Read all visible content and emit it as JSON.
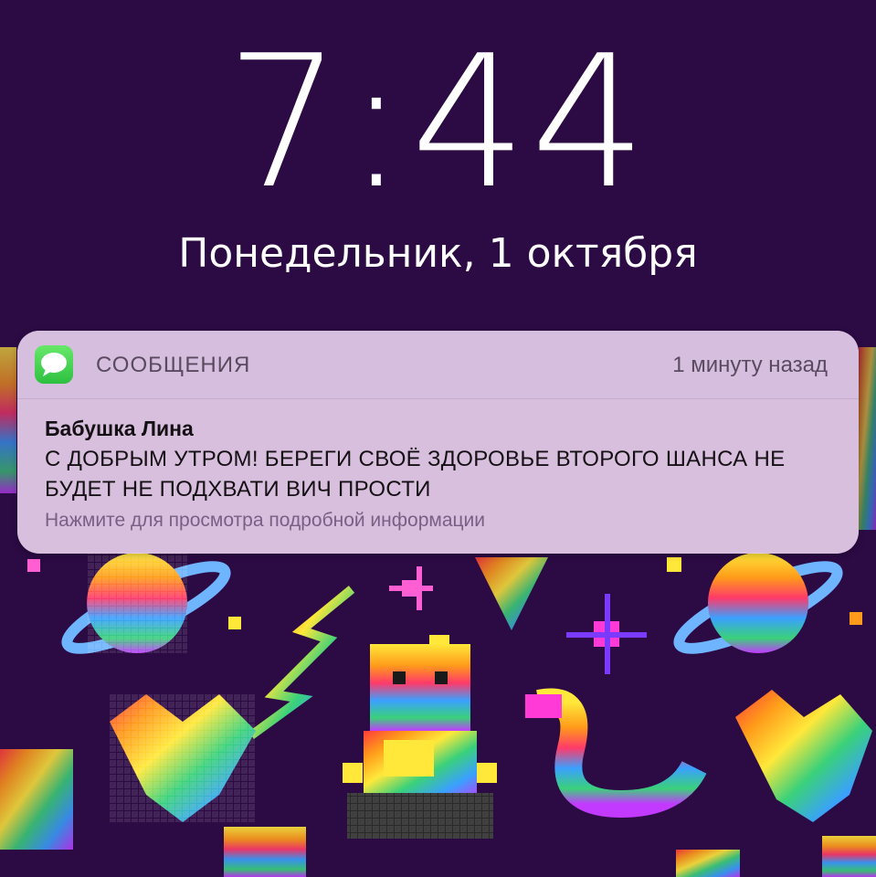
{
  "lockscreen": {
    "time": "7:44",
    "date": "Понедельник, 1 октября"
  },
  "notification": {
    "app_icon": "messages-icon",
    "app_name": "СООБЩЕНИЯ",
    "time_ago": "1 минуту назад",
    "sender": "Бабушка Лина",
    "message": "С ДОБРЫМ УТРОМ! БЕРЕГИ СВОЁ ЗДОРОВЬЕ ВТОРОГО ШАНСА НЕ БУДЕТ НЕ ПОДХВАТИ ВИЧ ПРОСТИ",
    "hint": "Нажмите для просмотра подробной информации"
  },
  "colors": {
    "background": "#2c0a44",
    "text": "#ffffff",
    "accent_green": "#4cd964"
  }
}
